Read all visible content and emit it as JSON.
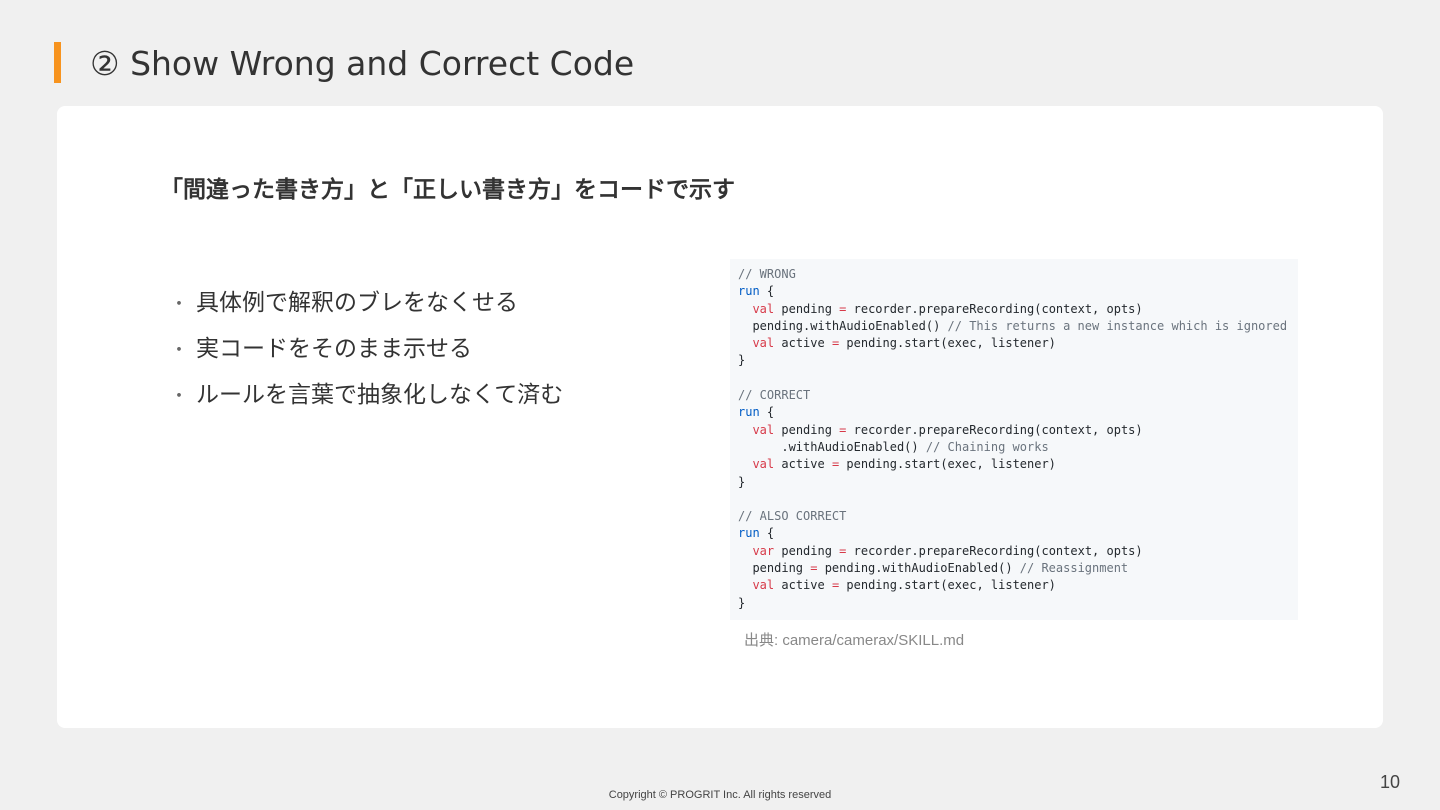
{
  "slide": {
    "title": "② Show Wrong and Correct Code",
    "subtitle": "「間違った書き方」と「正しい書き方」をコードで示す",
    "bullets": [
      "具体例で解釈のブレをなくせる",
      "実コードをそのまま示せる",
      "ルールを言葉で抽象化しなくて済む"
    ],
    "bullet_marker": "・",
    "code_lines": [
      [
        {
          "t": "// WRONG",
          "c": "cm"
        }
      ],
      [
        {
          "t": "run",
          "c": "kw"
        },
        {
          "t": " {",
          "c": ""
        }
      ],
      [
        {
          "t": "  ",
          "c": ""
        },
        {
          "t": "val",
          "c": "kw-red"
        },
        {
          "t": " pending ",
          "c": ""
        },
        {
          "t": "=",
          "c": "op"
        },
        {
          "t": " recorder.prepareRecording(context, opts)",
          "c": ""
        }
      ],
      [
        {
          "t": "  pending.withAudioEnabled() ",
          "c": ""
        },
        {
          "t": "// This returns a new instance which is ignored",
          "c": "cm"
        }
      ],
      [
        {
          "t": "  ",
          "c": ""
        },
        {
          "t": "val",
          "c": "kw-red"
        },
        {
          "t": " active ",
          "c": ""
        },
        {
          "t": "=",
          "c": "op"
        },
        {
          "t": " pending.start(exec, listener)",
          "c": ""
        }
      ],
      [
        {
          "t": "}",
          "c": ""
        }
      ],
      [
        {
          "t": "",
          "c": ""
        }
      ],
      [
        {
          "t": "// CORRECT",
          "c": "cm"
        }
      ],
      [
        {
          "t": "run",
          "c": "kw"
        },
        {
          "t": " {",
          "c": ""
        }
      ],
      [
        {
          "t": "  ",
          "c": ""
        },
        {
          "t": "val",
          "c": "kw-red"
        },
        {
          "t": " pending ",
          "c": ""
        },
        {
          "t": "=",
          "c": "op"
        },
        {
          "t": " recorder.prepareRecording(context, opts)",
          "c": ""
        }
      ],
      [
        {
          "t": "      .withAudioEnabled() ",
          "c": ""
        },
        {
          "t": "// Chaining works",
          "c": "cm"
        }
      ],
      [
        {
          "t": "  ",
          "c": ""
        },
        {
          "t": "val",
          "c": "kw-red"
        },
        {
          "t": " active ",
          "c": ""
        },
        {
          "t": "=",
          "c": "op"
        },
        {
          "t": " pending.start(exec, listener)",
          "c": ""
        }
      ],
      [
        {
          "t": "}",
          "c": ""
        }
      ],
      [
        {
          "t": "",
          "c": ""
        }
      ],
      [
        {
          "t": "// ALSO CORRECT",
          "c": "cm"
        }
      ],
      [
        {
          "t": "run",
          "c": "kw"
        },
        {
          "t": " {",
          "c": ""
        }
      ],
      [
        {
          "t": "  ",
          "c": ""
        },
        {
          "t": "var",
          "c": "kw-red"
        },
        {
          "t": " pending ",
          "c": ""
        },
        {
          "t": "=",
          "c": "op"
        },
        {
          "t": " recorder.prepareRecording(context, opts)",
          "c": ""
        }
      ],
      [
        {
          "t": "  pending ",
          "c": ""
        },
        {
          "t": "=",
          "c": "op"
        },
        {
          "t": " pending.withAudioEnabled() ",
          "c": ""
        },
        {
          "t": "// Reassignment",
          "c": "cm"
        }
      ],
      [
        {
          "t": "  ",
          "c": ""
        },
        {
          "t": "val",
          "c": "kw-red"
        },
        {
          "t": " active ",
          "c": ""
        },
        {
          "t": "=",
          "c": "op"
        },
        {
          "t": " pending.start(exec, listener)",
          "c": ""
        }
      ],
      [
        {
          "t": "}",
          "c": ""
        }
      ]
    ],
    "source": "出典: camera/camerax/SKILL.md",
    "footer": "Copyright © PROGRIT Inc. All rights reserved",
    "page_number": "10"
  },
  "colors": {
    "accent": "#f7931e",
    "background": "#f0f0f0",
    "card": "#ffffff",
    "code_bg": "#f6f8fa"
  }
}
